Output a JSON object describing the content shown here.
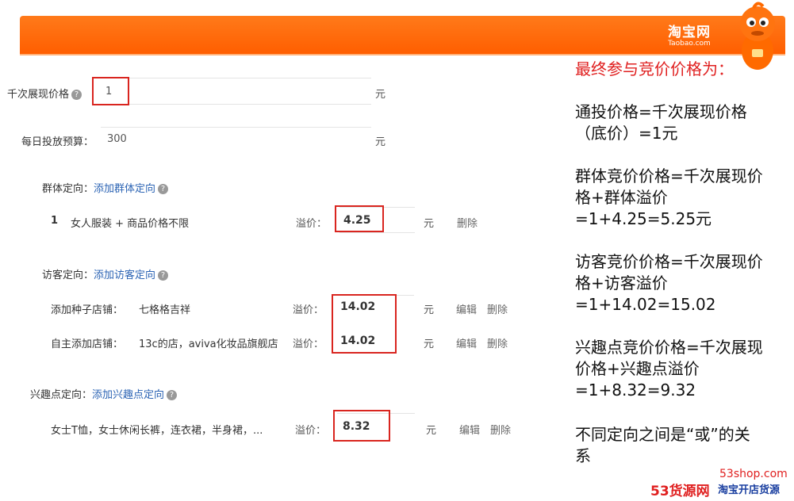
{
  "brand": {
    "logo_cn": "淘宝网",
    "logo_en": "Taobao.com"
  },
  "form": {
    "cpm_label": "千次展现价格",
    "cpm_value": "1",
    "unit": "元",
    "budget_label": "每日投放预算：",
    "budget_value": "300",
    "bid_label": "溢价：",
    "delete": "删除",
    "edit": "编辑",
    "group": {
      "title": "群体定向：",
      "add_link": "添加群体定向",
      "row_num": "1",
      "row_text": "女人服装 + 商品价格不限",
      "bid": "4.25"
    },
    "visitor": {
      "title": "访客定向：",
      "add_link": "添加访客定向",
      "rows": [
        {
          "label": "添加种子店铺：",
          "text": "七格格吉祥",
          "bid": "14.02"
        },
        {
          "label": "自主添加店铺：",
          "text": "13c的店，aviva化妆品旗舰店",
          "bid": "14.02"
        }
      ]
    },
    "interest": {
      "title": "兴趣点定向：",
      "add_link": "添加兴趣点定向",
      "row_text": "女士T恤，女士休闲长裤，连衣裙，半身裙，...",
      "bid": "8.32"
    }
  },
  "explanation": {
    "heading": "最终参与竞价价格为：",
    "p1": [
      "通投价格=千次展现价格",
      "（底价）=1元"
    ],
    "p2": [
      "群体竞价价格=千次展现价",
      "格+群体溢价",
      "=1+4.25=5.25元"
    ],
    "p3": [
      "访客竞价价格=千次展现价",
      "格+访客溢价",
      "=1+14.02=15.02"
    ],
    "p4": [
      "兴趣点竞价价格=千次展现",
      "价格+兴趣点溢价",
      "=1+8.32=9.32"
    ],
    "p5": [
      "不同定向之间是“或”的关",
      "系"
    ]
  },
  "footer": {
    "site": "53shop.com",
    "brand": "53货源网",
    "tagline": "淘宝开店货源"
  }
}
